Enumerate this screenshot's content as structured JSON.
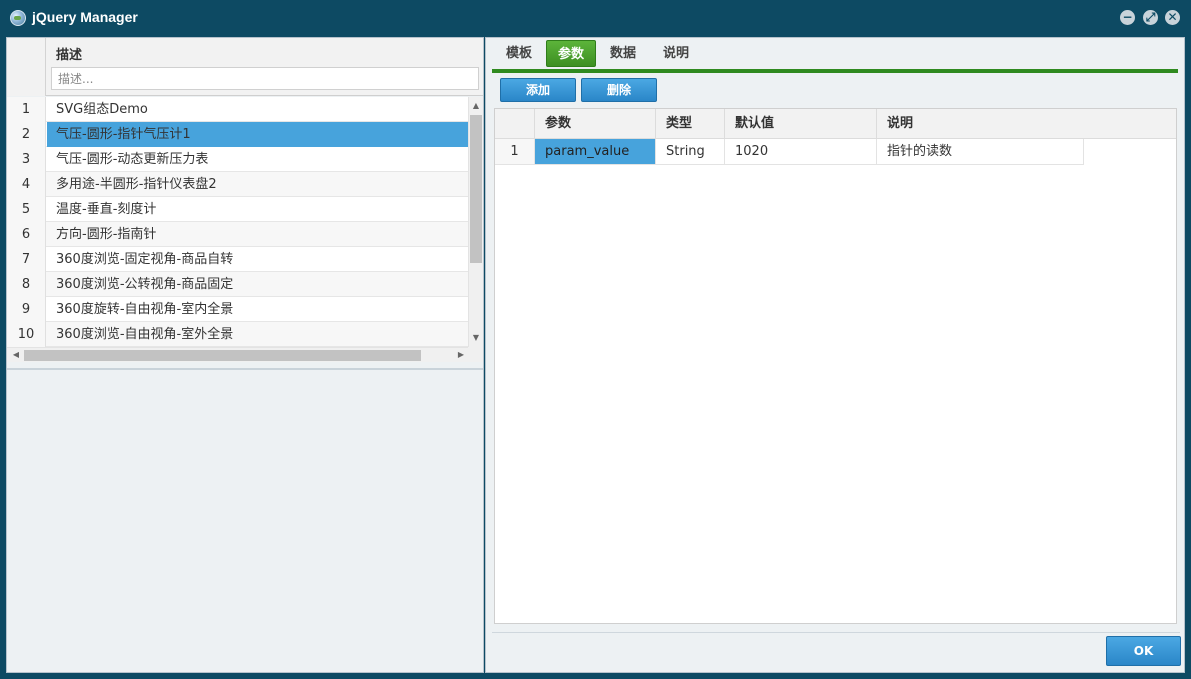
{
  "window": {
    "title": "jQuery Manager",
    "controls": {
      "minimize": "−",
      "maximize": "⤢",
      "close": "✕"
    }
  },
  "left_panel": {
    "column_header": "描述",
    "filter_placeholder": "描述...",
    "rows": [
      {
        "num": "1",
        "text": "SVG组态Demo"
      },
      {
        "num": "2",
        "text": "气压-圆形-指针气压计1"
      },
      {
        "num": "3",
        "text": "气压-圆形-动态更新压力表"
      },
      {
        "num": "4",
        "text": "多用途-半圆形-指针仪表盘2"
      },
      {
        "num": "5",
        "text": "温度-垂直-刻度计"
      },
      {
        "num": "6",
        "text": "方向-圆形-指南针"
      },
      {
        "num": "7",
        "text": "360度浏览-固定视角-商品自转"
      },
      {
        "num": "8",
        "text": "360度浏览-公转视角-商品固定"
      },
      {
        "num": "9",
        "text": "360度旋转-自由视角-室内全景"
      },
      {
        "num": "10",
        "text": "360度浏览-自由视角-室外全景"
      }
    ],
    "selected_row": "2",
    "scroll": {
      "up": "▲",
      "down": "▼",
      "left": "◀",
      "right": "▶"
    }
  },
  "right_panel": {
    "tabs": [
      {
        "id": "template",
        "label": "模板"
      },
      {
        "id": "params",
        "label": "参数",
        "active": true
      },
      {
        "id": "data",
        "label": "数据"
      },
      {
        "id": "desc",
        "label": "说明"
      }
    ],
    "buttons": {
      "add": "添加",
      "delete": "删除"
    },
    "table": {
      "headers": {
        "param": "参数",
        "type": "类型",
        "default": "默认值",
        "desc": "说明"
      },
      "rows": [
        {
          "num": "1",
          "param": "param_value",
          "type": "String",
          "default": "1020",
          "desc": "指针的读数"
        }
      ]
    }
  },
  "footer": {
    "ok": "OK"
  },
  "colors": {
    "titlebar": "#0d4a63",
    "selection": "#47a3dc",
    "active_tab": "#3d8f22",
    "button": "#2a86c8"
  }
}
